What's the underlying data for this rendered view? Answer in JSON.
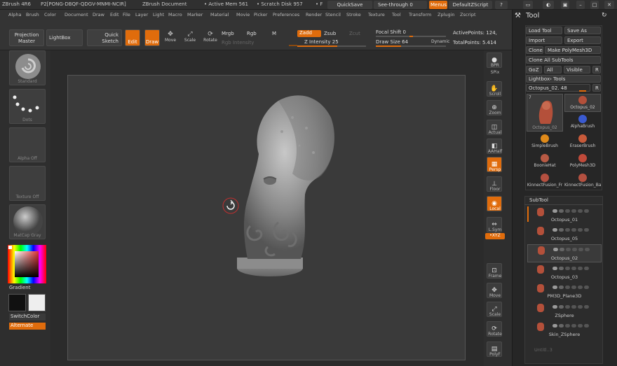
{
  "title": {
    "app": "ZBrush 4R6",
    "serial": "P2[PONG-DBQF-QDGV-MNMI-NCIR]",
    "document": "ZBrush Document",
    "mem": "• Active Mem 561",
    "scratch": "• Scratch Disk 957",
    "tail": "• F",
    "quicksave": "QuickSave",
    "seethrough": "See-through",
    "seethrough_val": "0",
    "menus": "Menus",
    "script": "DefaultZScript"
  },
  "menu": [
    "Alpha",
    "Brush",
    "Color",
    "Document",
    "Draw",
    "Edit",
    "File",
    "Layer",
    "Light",
    "Macro",
    "Marker",
    "Material",
    "Movie",
    "Picker",
    "Preferences",
    "Render",
    "Stencil",
    "Stroke",
    "Texture",
    "Tool",
    "Transform",
    "Zplugin",
    "Zscript"
  ],
  "shelf": {
    "projection": "Projection",
    "master": "Master",
    "lightbox": "LightBox",
    "quick": "Quick",
    "sketch": "Sketch",
    "edit": "Edit",
    "draw": "Draw",
    "move": "Move",
    "scale": "Scale",
    "rotate": "Rotate",
    "mrgb": "Mrgb",
    "rgb": "Rgb",
    "m": "M",
    "rgb_intensity": "Rgb Intensity",
    "zadd": "Zadd",
    "zsub": "Zsub",
    "zcut": "Zcut",
    "z_intensity": "Z Intensity",
    "z_intensity_val": "25",
    "focal_shift": "Focal Shift",
    "focal_shift_val": "0",
    "draw_size": "Draw Size",
    "draw_size_val": "64",
    "dynamic": "Dynamic",
    "active_points": "ActivePoints:",
    "active_points_val": "124,",
    "total_points": "TotalPoints:",
    "total_points_val": "5.414"
  },
  "left": {
    "standard": "Standard",
    "dots": "Dots",
    "alpha": "Alpha  Off",
    "texture": "Texture  Off",
    "matcap": "MatCap  Gray",
    "gradient": "Gradient",
    "switchcolor": "SwitchColor",
    "alternate": "Alternate"
  },
  "right_strip": {
    "bpr": "BPR",
    "spix": "SPix",
    "scroll": "Scroll",
    "zoom": "Zoom",
    "actual": "Actual",
    "aahalf": "AAHalf",
    "persp": "Persp",
    "floor": "Floor",
    "local": "Local",
    "lsym": "L.Sym",
    "xyz": "•XYZ",
    "frame": "Frame",
    "move": "Move",
    "scale": "Scale",
    "rotate": "Rotate",
    "polyf": "PolyF"
  },
  "tool_palette": {
    "title": "Tool",
    "load_tool": "Load Tool",
    "save_as": "Save As",
    "import": "Import",
    "export": "Export",
    "clone": "Clone",
    "make_polymesh": "Make PolyMesh3D",
    "clone_all": "Clone  All  SubTools",
    "goz": "GoZ",
    "all": "All",
    "visible": "Visible",
    "r": "R",
    "lightbox_tools": "Lightbox› Tools",
    "current": "Octopus_02. 48",
    "tools": [
      {
        "name": "Octopus_02",
        "badge": "7"
      },
      {
        "name": "AlphaBrush"
      },
      {
        "name": "SimpleBrush"
      },
      {
        "name": "EraserBrush"
      },
      {
        "name": "BoonieHat"
      },
      {
        "name": "PolyMesh3D"
      },
      {
        "name": "KinnectFusion_Fr"
      },
      {
        "name": "KinnectFusion_Ba"
      }
    ],
    "thumb_big_label": "Octopus_02",
    "thumb_big_badge": "7"
  },
  "subtool": {
    "header": "SubTool",
    "items": [
      "Octopus_01",
      "Octopus_05",
      "Octopus_02",
      "Octopus_03",
      "PM3D_Plane3D",
      "ZSphere",
      "Skin_ZSphere"
    ],
    "footer": "Untitl..3"
  },
  "colors": {
    "accent": "#e06c0c",
    "panel": "#262626",
    "canvas": "#3a3a3a"
  }
}
